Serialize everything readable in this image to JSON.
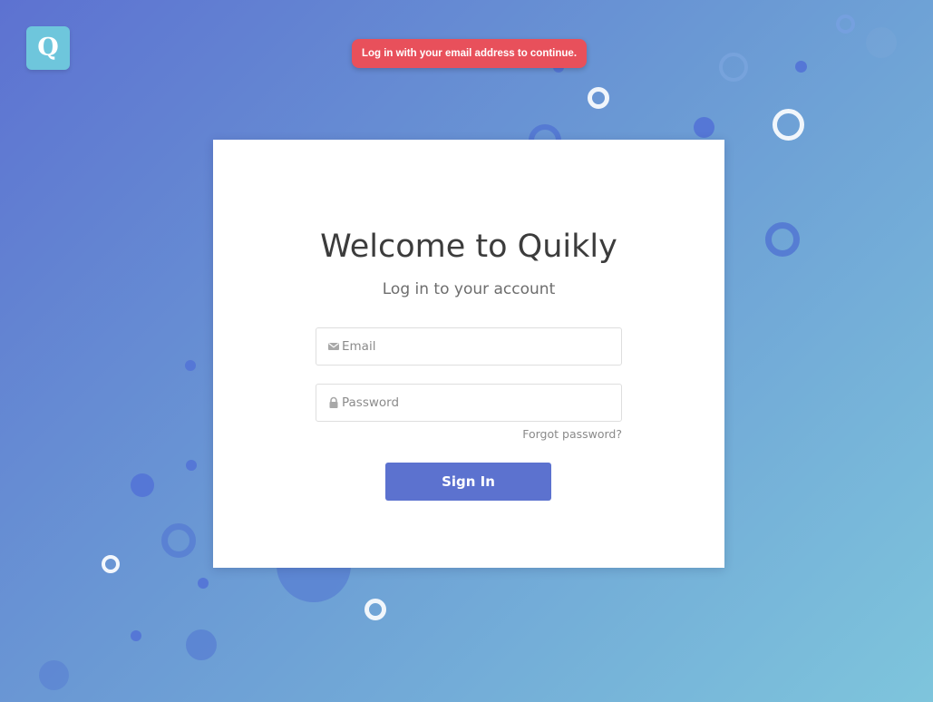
{
  "logo": {
    "letter": "Q"
  },
  "toast": {
    "message": "Log in with your email address to continue."
  },
  "login": {
    "title": "Welcome to Quikly",
    "subtitle": "Log in to your account",
    "email": {
      "placeholder": "Email",
      "value": "",
      "icon": "mail-icon"
    },
    "password": {
      "placeholder": "Password",
      "value": "",
      "icon": "lock-icon"
    },
    "forgot_label": "Forgot password?",
    "signin_label": "Sign In"
  },
  "colors": {
    "toast": "#e8505b",
    "button": "#5c72cf",
    "logo": "#6ec6dc",
    "gradient_start": "#5d72d1",
    "gradient_end": "#7ec5dc"
  }
}
